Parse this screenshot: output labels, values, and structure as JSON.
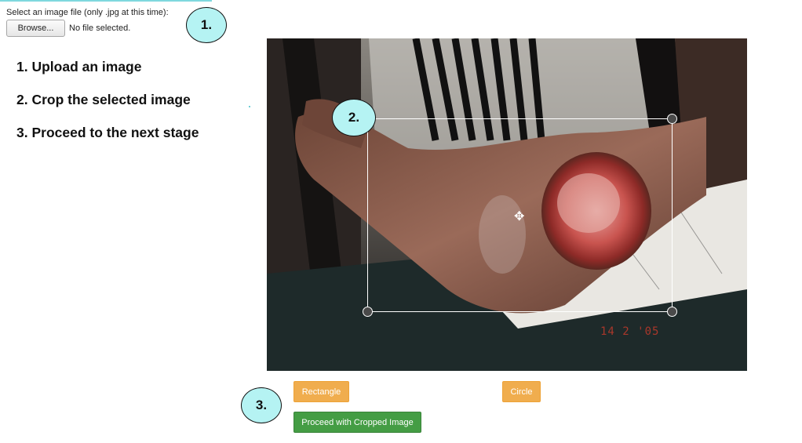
{
  "upload": {
    "label": "Select an image file (only .jpg at this time):",
    "browse_label": "Browse...",
    "status": "No file selected."
  },
  "badges": [
    "1.",
    "2.",
    "3."
  ],
  "steps": [
    "1. Upload an image",
    "2. Crop the selected image",
    "3. Proceed to the next stage"
  ],
  "cropper": {
    "date_stamp": "14 2 '05"
  },
  "buttons": {
    "rectangle": "Rectangle",
    "circle": "Circle",
    "proceed": "Proceed with Cropped Image"
  },
  "colors": {
    "badge_fill": "#b5f3f3",
    "orange_button": "#f0ad4e",
    "green_button": "#449d44"
  },
  "icons": {
    "move": "move-icon"
  }
}
